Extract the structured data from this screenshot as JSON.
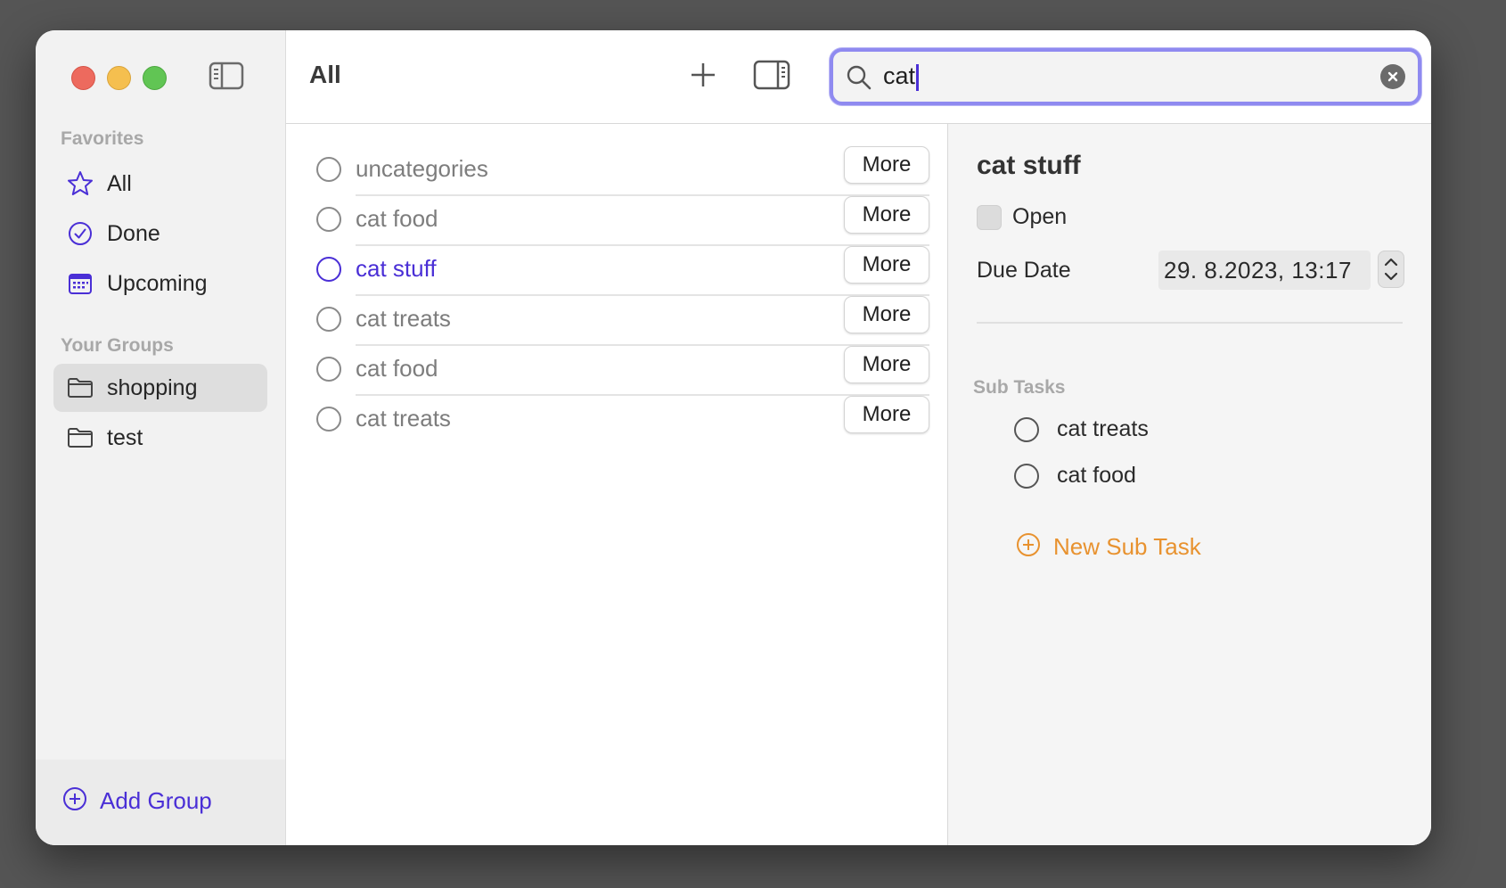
{
  "sidebar": {
    "favorites_label": "Favorites",
    "favorites": [
      {
        "label": "All",
        "icon": "star-icon"
      },
      {
        "label": "Done",
        "icon": "checkmark-circle-icon"
      },
      {
        "label": "Upcoming",
        "icon": "calendar-icon"
      }
    ],
    "groups_label": "Your Groups",
    "groups": [
      {
        "label": "shopping",
        "icon": "folder-icon",
        "selected": true
      },
      {
        "label": "test",
        "icon": "folder-icon",
        "selected": false
      }
    ],
    "add_group_label": "Add Group"
  },
  "toolbar": {
    "title": "All"
  },
  "search": {
    "value": "cat"
  },
  "tasks": [
    {
      "title": "uncategories",
      "more_label": "More"
    },
    {
      "title": "cat food",
      "more_label": "More"
    },
    {
      "title": "cat stuff",
      "more_label": "More",
      "selected": true
    },
    {
      "title": "cat treats",
      "more_label": "More"
    },
    {
      "title": "cat food",
      "more_label": "More"
    },
    {
      "title": "cat treats",
      "more_label": "More"
    }
  ],
  "detail": {
    "title": "cat stuff",
    "open_label": "Open",
    "due_label": "Due Date",
    "due_value": "29.  8.2023, 13:17",
    "subtasks_label": "Sub Tasks",
    "subtasks": [
      {
        "title": "cat treats"
      },
      {
        "title": "cat food"
      }
    ],
    "new_subtask_label": "New Sub Task"
  },
  "colors": {
    "accent": "#4a2fd6",
    "orange": "#e8922f",
    "search_focus": "#8f8af0"
  }
}
